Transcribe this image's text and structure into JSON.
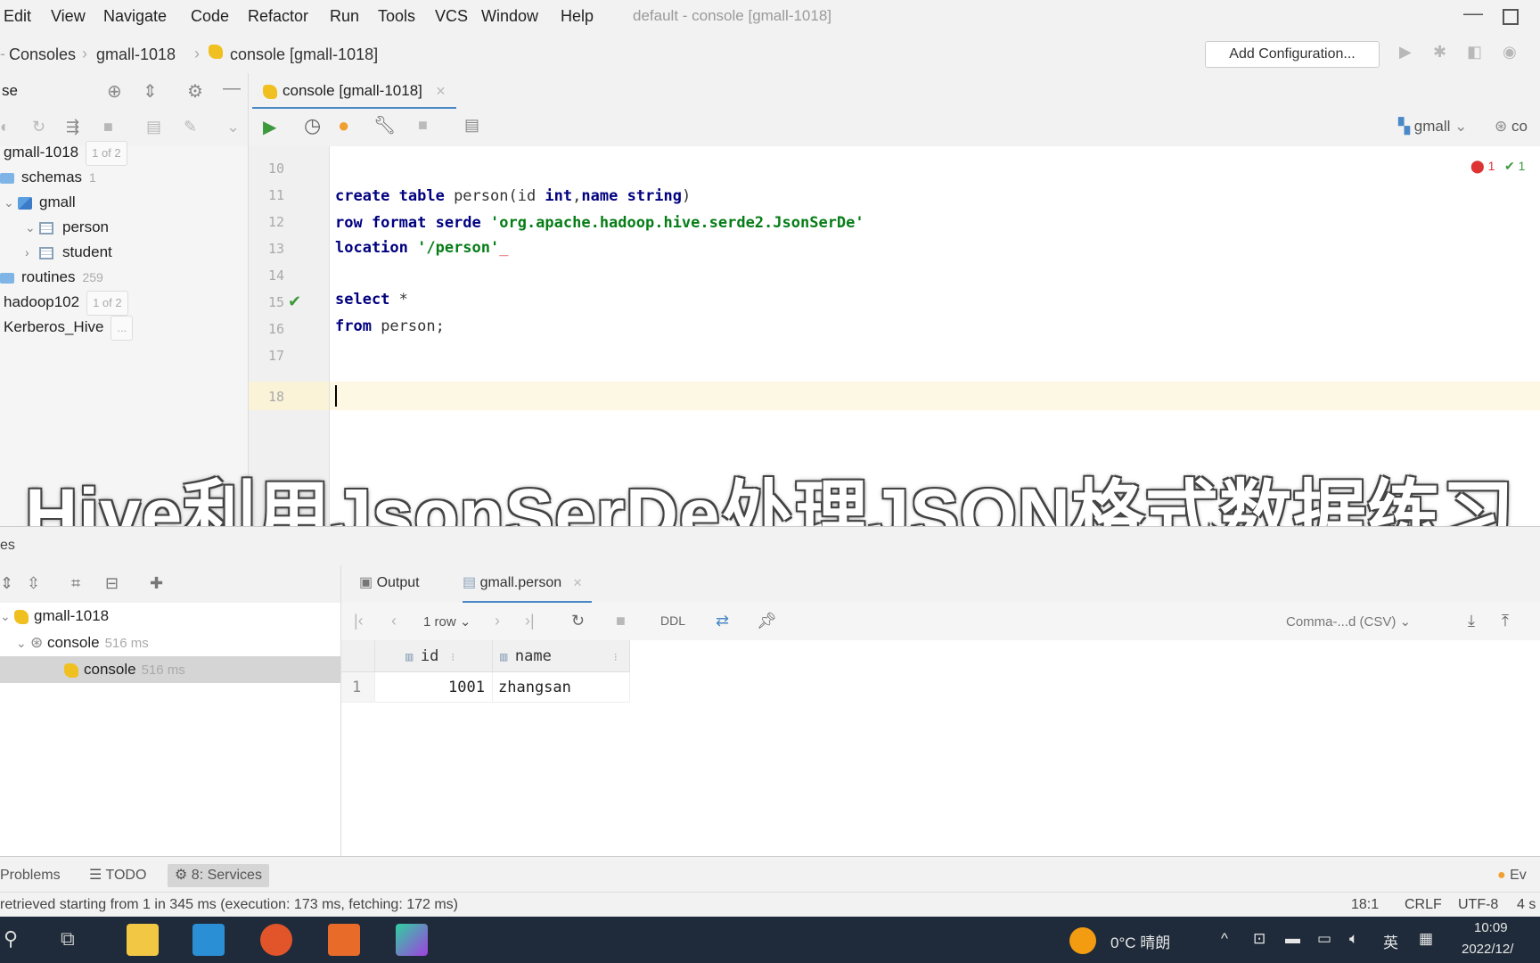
{
  "menu": {
    "items": [
      "Edit",
      "View",
      "Navigate",
      "Code",
      "Refactor",
      "Run",
      "Tools",
      "VCS",
      "Window",
      "Help"
    ],
    "window_title": "default - console [gmall-1018]"
  },
  "nav": {
    "crumbs": [
      "Consoles",
      "gmall-1018",
      "console [gmall-1018]"
    ],
    "add_configuration": "Add Configuration..."
  },
  "left_panel": {
    "title": "se",
    "tree": [
      {
        "label": "gmall-1018",
        "badge": "1 of 2"
      },
      {
        "label": "schemas",
        "count": "1"
      },
      {
        "label": "gmall"
      },
      {
        "label": "person"
      },
      {
        "label": "student"
      },
      {
        "label": "routines",
        "count": "259"
      },
      {
        "label": "hadoop102",
        "badge": "1 of 2"
      },
      {
        "label": "Kerberos_Hive",
        "badge": "..."
      }
    ]
  },
  "editor": {
    "tab_label": "console [gmall-1018]",
    "schema_selector": "gmall",
    "session_selector": "co",
    "problems": {
      "errors": "1",
      "ok": "1"
    },
    "line_numbers": [
      "10",
      "11",
      "12",
      "13",
      "14",
      "15",
      "16",
      "17",
      "18"
    ],
    "code": {
      "l11": {
        "k1": "create table",
        "t1": " person(id ",
        "k2": "int",
        "t2": ",",
        "k3": "name",
        "t3": " ",
        "k4": "string",
        "t4": ")"
      },
      "l12": {
        "k1": "row format serde",
        "s1": " 'org.apache.hadoop.hive.serde2.JsonSerDe'"
      },
      "l13": {
        "k1": "location",
        "s1": " '/person'",
        "t1": "_"
      },
      "l15": {
        "k1": "select",
        "t1": " *"
      },
      "l16": {
        "k1": "from",
        "t1": " person;"
      }
    }
  },
  "caption": "Hive利用JsonSerDe处理JSON格式数据练习",
  "services": {
    "title": "es",
    "tree": [
      {
        "label": "gmall-1018"
      },
      {
        "label": "console",
        "time": "516 ms"
      },
      {
        "label": "console",
        "time": "516 ms"
      }
    ],
    "tabs": [
      "Output",
      "gmall.person"
    ],
    "rows_label": "1 row",
    "ddl": "DDL",
    "export_format": "Comma-...d (CSV)",
    "columns": [
      "id",
      "name"
    ],
    "rows": [
      {
        "n": "1",
        "id": "1001",
        "name": "zhangsan"
      }
    ]
  },
  "bottom_tabs": [
    "Problems",
    "TODO",
    "8: Services"
  ],
  "event_log": "Ev",
  "status": {
    "message": "retrieved starting from 1 in 345 ms (execution: 173 ms, fetching: 172 ms)",
    "position": "18:1",
    "line_ending": "CRLF",
    "encoding": "UTF-8",
    "indent": "4 s"
  },
  "taskbar": {
    "weather": "0°C 晴朗",
    "ime": "英",
    "time": "10:09",
    "date": "2022/12/"
  },
  "colors": {
    "accent": "#4a88c7",
    "keyword": "#000080",
    "string": "#067d17",
    "taskbar": "#1f2b3a"
  }
}
